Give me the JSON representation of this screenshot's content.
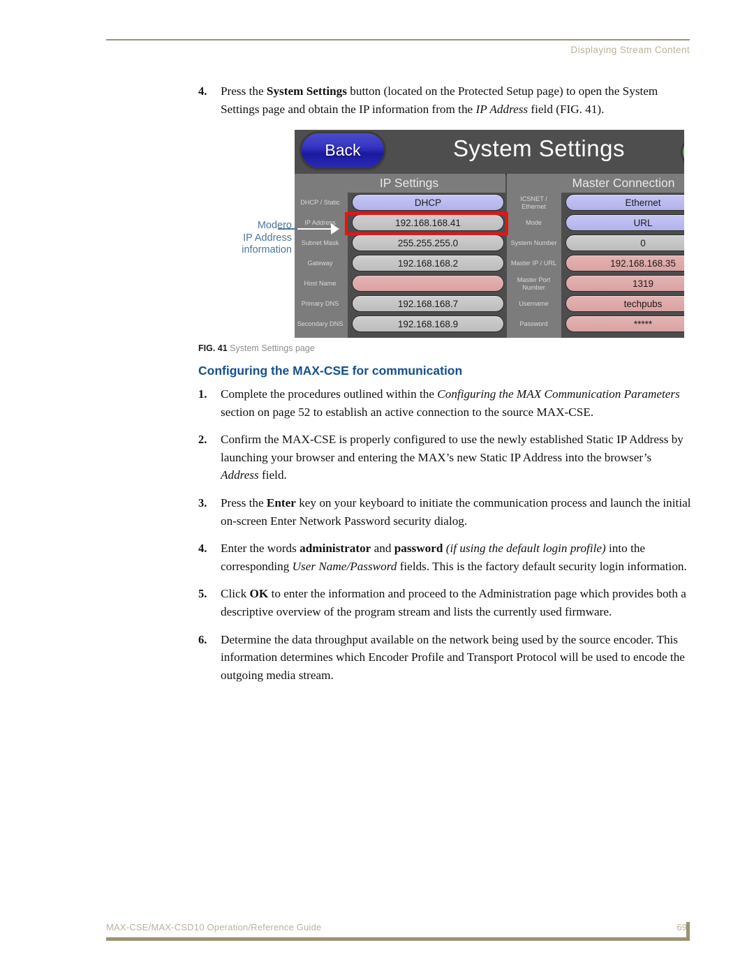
{
  "header": {
    "title": "Displaying Stream Content"
  },
  "steps_top": [
    {
      "num": "4.",
      "html": "Press the <b>System Settings</b> button (located on the Protected Setup page) to open the System Settings page and obtain the IP information from the <i>IP Address</i> field (FIG. 41)."
    }
  ],
  "figure": {
    "callout": {
      "line1": "Modero",
      "line2": "IP Address",
      "line3": "information"
    },
    "device": {
      "back_label": "Back",
      "screen_title": "System Settings",
      "status_indicator": "green-indicator",
      "panels": [
        {
          "title": "IP Settings",
          "rows": [
            {
              "label": "DHCP / Static",
              "value": "DHCP",
              "style": "lavender"
            },
            {
              "label": "IP Address",
              "value": "192.168.168.41",
              "style": "gray",
              "highlighted": true
            },
            {
              "label": "Subnet Mask",
              "value": "255.255.255.0",
              "style": "gray"
            },
            {
              "label": "Gateway",
              "value": "192.168.168.2",
              "style": "gray"
            },
            {
              "label": "Host Name",
              "value": "",
              "style": "rose"
            },
            {
              "label": "Primary DNS",
              "value": "192.168.168.7",
              "style": "gray"
            },
            {
              "label": "Secondary DNS",
              "value": "192.168.168.9",
              "style": "gray"
            }
          ]
        },
        {
          "title": "Master Connection",
          "rows": [
            {
              "label": "ICSNET / Ethernet",
              "value": "Ethernet",
              "style": "lavender"
            },
            {
              "label": "Mode",
              "value": "URL",
              "style": "lavender"
            },
            {
              "label": "System Number",
              "value": "0",
              "style": "gray"
            },
            {
              "label": "Master IP / URL",
              "value": "192.168.168.35",
              "style": "rose"
            },
            {
              "label": "Master Port Number",
              "value": "1319",
              "style": "rose"
            },
            {
              "label": "Username",
              "value": "techpubs",
              "style": "rose"
            },
            {
              "label": "Password",
              "value": "*****",
              "style": "rose"
            }
          ]
        }
      ]
    },
    "caption_label": "FIG. 41",
    "caption_text": "System Settings page"
  },
  "section": {
    "heading": "Configuring the MAX-CSE for communication"
  },
  "steps_bottom": [
    {
      "num": "1.",
      "html": "Complete the procedures outlined within the <i>Configuring the MAX Communication Parameters</i> section on page 52 to establish an active connection to the source MAX-CSE."
    },
    {
      "num": "2.",
      "html": "Confirm the MAX-CSE is properly configured to use the newly established Static IP Address by launching your browser and entering the MAX&rsquo;s new Static IP Address into the browser&rsquo;s <i>Address</i> field."
    },
    {
      "num": "3.",
      "html": "Press the <b>Enter</b> key on your keyboard to initiate the communication process and launch the initial on-screen Enter Network Password security dialog."
    },
    {
      "num": "4.",
      "html": "Enter the words <b>administrator</b> and <b>password</b> <i>(if using the default login profile)</i> into the corresponding <i>User Name/Password</i> fields. This is the factory default security login information."
    },
    {
      "num": "5.",
      "html": "Click <b>OK</b> to enter the information and proceed to the Administration page which provides both a descriptive overview of the program stream and lists the currently used firmware."
    },
    {
      "num": "6.",
      "html": "Determine the data throughput available on the network being used by the source encoder. This information determines which Encoder Profile and Transport Protocol will be used to encode the outgoing media stream."
    }
  ],
  "footer": {
    "document_title": "MAX-CSE/MAX-CSD10 Operation/Reference Guide",
    "page_number": "69"
  },
  "colors": {
    "rule": "#9c9374",
    "header_text": "#b9b29a",
    "heading_blue": "#15508e",
    "callout_blue": "#4a77a0",
    "highlight_red": "#ee1111",
    "field_lavender": "#b8b8ee",
    "field_gray": "#c5c5c5",
    "field_rose": "#dda8a8",
    "panel_gray": "#7c7c7c",
    "device_dark": "#4d4d4d",
    "back_blue": "#2a2ab4",
    "indicator_green": "#18e018"
  }
}
